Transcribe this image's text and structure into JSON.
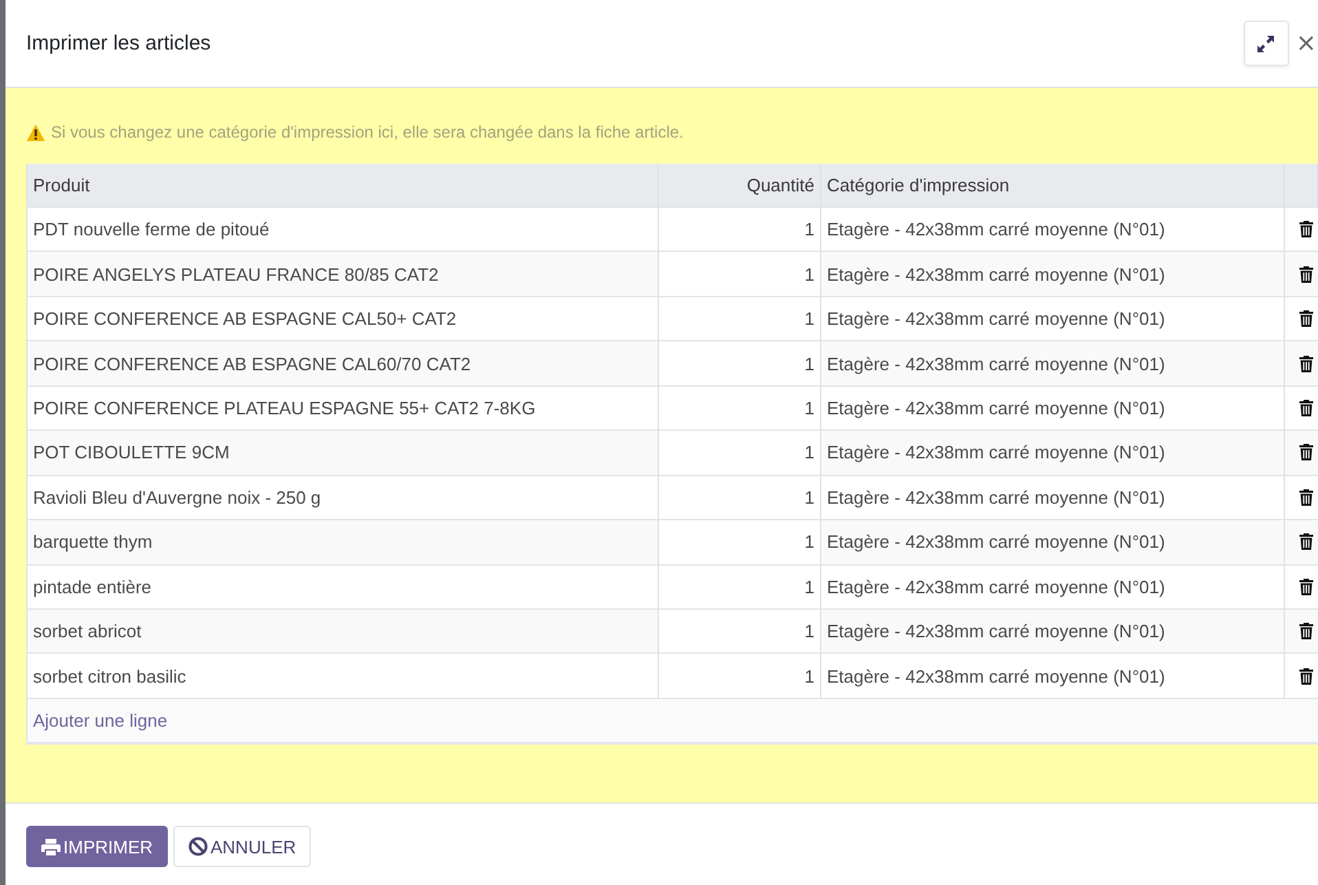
{
  "dialog": {
    "title": "Imprimer les articles",
    "close_label": "×"
  },
  "notice": {
    "text": "Si vous changez une catégorie d'impression ici, elle sera changée dans la fiche article."
  },
  "table": {
    "columns": [
      "Produit",
      "Quantité",
      "Catégorie d'impression"
    ],
    "rows": [
      {
        "product": "PDT nouvelle ferme de pitoué",
        "quantity": "1",
        "category": "Etagère - 42x38mm carré moyenne (N°01)"
      },
      {
        "product": "POIRE ANGELYS PLATEAU FRANCE 80/85 CAT2",
        "quantity": "1",
        "category": "Etagère - 42x38mm carré moyenne (N°01)"
      },
      {
        "product": "POIRE CONFERENCE AB ESPAGNE CAL50+ CAT2",
        "quantity": "1",
        "category": "Etagère - 42x38mm carré moyenne (N°01)"
      },
      {
        "product": "POIRE CONFERENCE AB ESPAGNE CAL60/70 CAT2",
        "quantity": "1",
        "category": "Etagère - 42x38mm carré moyenne (N°01)"
      },
      {
        "product": "POIRE CONFERENCE PLATEAU ESPAGNE 55+ CAT2 7-8KG",
        "quantity": "1",
        "category": "Etagère - 42x38mm carré moyenne (N°01)"
      },
      {
        "product": "POT CIBOULETTE 9CM",
        "quantity": "1",
        "category": "Etagère - 42x38mm carré moyenne (N°01)"
      },
      {
        "product": "Ravioli Bleu d'Auvergne noix - 250 g",
        "quantity": "1",
        "category": "Etagère - 42x38mm carré moyenne (N°01)"
      },
      {
        "product": "barquette thym",
        "quantity": "1",
        "category": "Etagère - 42x38mm carré moyenne (N°01)"
      },
      {
        "product": "pintade entière",
        "quantity": "1",
        "category": "Etagère - 42x38mm carré moyenne (N°01)"
      },
      {
        "product": "sorbet abricot",
        "quantity": "1",
        "category": "Etagère - 42x38mm carré moyenne (N°01)"
      },
      {
        "product": "sorbet citron basilic",
        "quantity": "1",
        "category": "Etagère - 42x38mm carré moyenne (N°01)"
      }
    ],
    "add_line": "Ajouter une ligne"
  },
  "buttons": [
    {
      "label": "IMPRIMER",
      "kind": "primary"
    },
    {
      "label": "ANNULER",
      "kind": "secondary"
    }
  ]
}
